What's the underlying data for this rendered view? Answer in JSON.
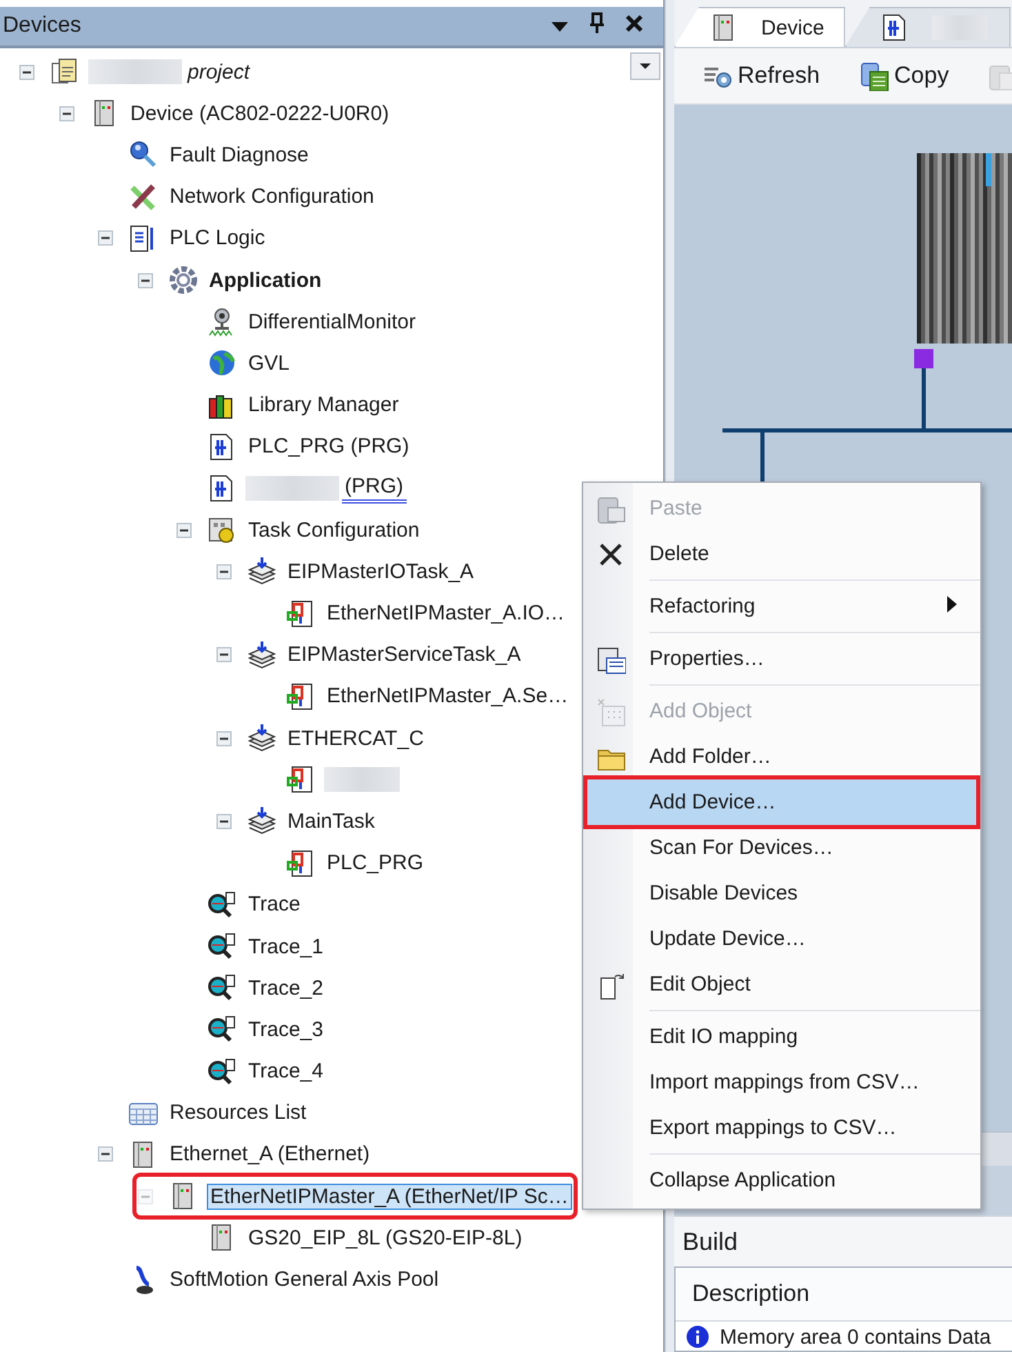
{
  "panel": {
    "title": "Devices"
  },
  "tree": [
    {
      "label": "project",
      "kind": "project",
      "blurred": true,
      "expanded": true,
      "selected": false,
      "children": [
        {
          "label": "Device (AC802-0222-U0R0)",
          "kind": "device",
          "expanded": true,
          "selected": false,
          "children": [
            {
              "label": "Fault Diagnose",
              "kind": "diagnose",
              "selected": false
            },
            {
              "label": "Network Configuration",
              "kind": "network",
              "selected": false
            },
            {
              "label": "PLC Logic",
              "kind": "plc-logic",
              "expanded": true,
              "selected": false,
              "children": [
                {
                  "label": "Application",
                  "kind": "application",
                  "active": true,
                  "expanded": true,
                  "selected": false,
                  "children": [
                    {
                      "label": "DifferentialMonitor",
                      "kind": "monitor",
                      "selected": false
                    },
                    {
                      "label": "GVL",
                      "kind": "gvl",
                      "selected": false
                    },
                    {
                      "label": "Library Manager",
                      "kind": "library",
                      "selected": false
                    },
                    {
                      "label": "PLC_PRG (PRG)",
                      "kind": "pou",
                      "selected": false
                    },
                    {
                      "label": "(PRG)",
                      "kind": "pou",
                      "blurred": true,
                      "underlined": true,
                      "selected": false
                    },
                    {
                      "label": "Task Configuration",
                      "kind": "task-config",
                      "expanded": true,
                      "selected": false,
                      "children": [
                        {
                          "label": "EIPMasterIOTask_A",
                          "kind": "task",
                          "expanded": true,
                          "selected": false,
                          "children": [
                            {
                              "label": "EtherNetIPMaster_A.IO…",
                              "kind": "program-call",
                              "selected": false
                            }
                          ]
                        },
                        {
                          "label": "EIPMasterServiceTask_A",
                          "kind": "task",
                          "expanded": true,
                          "selected": false,
                          "children": [
                            {
                              "label": "EtherNetIPMaster_A.Se…",
                              "kind": "program-call",
                              "selected": false
                            }
                          ]
                        },
                        {
                          "label": "ETHERCAT_C",
                          "kind": "task",
                          "expanded": true,
                          "selected": false,
                          "children": [
                            {
                              "kind": "program-call",
                              "blurred": true,
                              "selected": false
                            }
                          ]
                        },
                        {
                          "label": "MainTask",
                          "kind": "task",
                          "expanded": true,
                          "selected": false,
                          "children": [
                            {
                              "label": "PLC_PRG",
                              "kind": "program-call",
                              "selected": false
                            }
                          ]
                        }
                      ]
                    },
                    {
                      "label": "Trace",
                      "kind": "trace",
                      "selected": false
                    },
                    {
                      "label": "Trace_1",
                      "kind": "trace",
                      "selected": false
                    },
                    {
                      "label": "Trace_2",
                      "kind": "trace",
                      "selected": false
                    },
                    {
                      "label": "Trace_3",
                      "kind": "trace",
                      "selected": false
                    },
                    {
                      "label": "Trace_4",
                      "kind": "trace",
                      "selected": false
                    }
                  ]
                }
              ]
            },
            {
              "label": "Resources List",
              "kind": "resources",
              "selected": false
            },
            {
              "label": "Ethernet_A (Ethernet)",
              "kind": "device",
              "expanded": true,
              "selected": false,
              "children": [
                {
                  "label": "EtherNetIPMaster_A (EtherNet/IP Sc…",
                  "kind": "device",
                  "expanded": true,
                  "selected": true,
                  "annotated": true,
                  "children": [
                    {
                      "label": "GS20_EIP_8L (GS20-EIP-8L)",
                      "kind": "device",
                      "selected": false
                    }
                  ]
                }
              ]
            },
            {
              "label": "SoftMotion General Axis Pool",
              "kind": "softmotion",
              "selected": false
            }
          ]
        }
      ]
    }
  ],
  "editor": {
    "tabs": [
      {
        "label": "Device",
        "kind": "device",
        "selected": true
      },
      {
        "kind": "pou",
        "blurred": true,
        "selected": false
      }
    ],
    "toolbar": [
      {
        "label": "Refresh",
        "kind": "refresh",
        "disabled": false
      },
      {
        "label": "Copy",
        "kind": "copy",
        "disabled": false
      },
      {
        "kind": "paste",
        "disabled": true
      }
    ]
  },
  "messages": {
    "section": "Build",
    "columns": [
      "Description"
    ],
    "rows": [
      {
        "kind": "info",
        "text": "Memory area 0 contains  Data"
      }
    ]
  },
  "context_menu": {
    "items": [
      {
        "kind": "item",
        "label": "Paste",
        "disabled": true,
        "selected": false
      },
      {
        "kind": "item",
        "label": "Delete",
        "disabled": false,
        "selected": false
      },
      {
        "kind": "separator"
      },
      {
        "kind": "item",
        "label": "Refactoring",
        "submenu": true,
        "disabled": false,
        "selected": false
      },
      {
        "kind": "separator"
      },
      {
        "kind": "item",
        "label": "Properties…",
        "disabled": false,
        "selected": false
      },
      {
        "kind": "separator"
      },
      {
        "kind": "item",
        "label": "Add Object",
        "disabled": true,
        "selected": false
      },
      {
        "kind": "item",
        "label": "Add Folder…",
        "disabled": false,
        "selected": false
      },
      {
        "kind": "item",
        "label": "Add Device…",
        "disabled": false,
        "selected": true,
        "annotated": true
      },
      {
        "kind": "item",
        "label": "Scan For Devices…",
        "disabled": false,
        "selected": false
      },
      {
        "kind": "item",
        "label": "Disable Devices",
        "disabled": false,
        "selected": false
      },
      {
        "kind": "item",
        "label": "Update Device…",
        "disabled": false,
        "selected": false
      },
      {
        "kind": "item",
        "label": "Edit Object",
        "disabled": false,
        "selected": false
      },
      {
        "kind": "separator"
      },
      {
        "kind": "item",
        "label": "Edit IO mapping",
        "disabled": false,
        "selected": false
      },
      {
        "kind": "item",
        "label": "Import mappings from CSV…",
        "disabled": false,
        "selected": false
      },
      {
        "kind": "item",
        "label": "Export mappings to CSV…",
        "disabled": false,
        "selected": false
      },
      {
        "kind": "separator"
      },
      {
        "kind": "item",
        "label": "Collapse Application",
        "disabled": false,
        "selected": false
      }
    ]
  }
}
